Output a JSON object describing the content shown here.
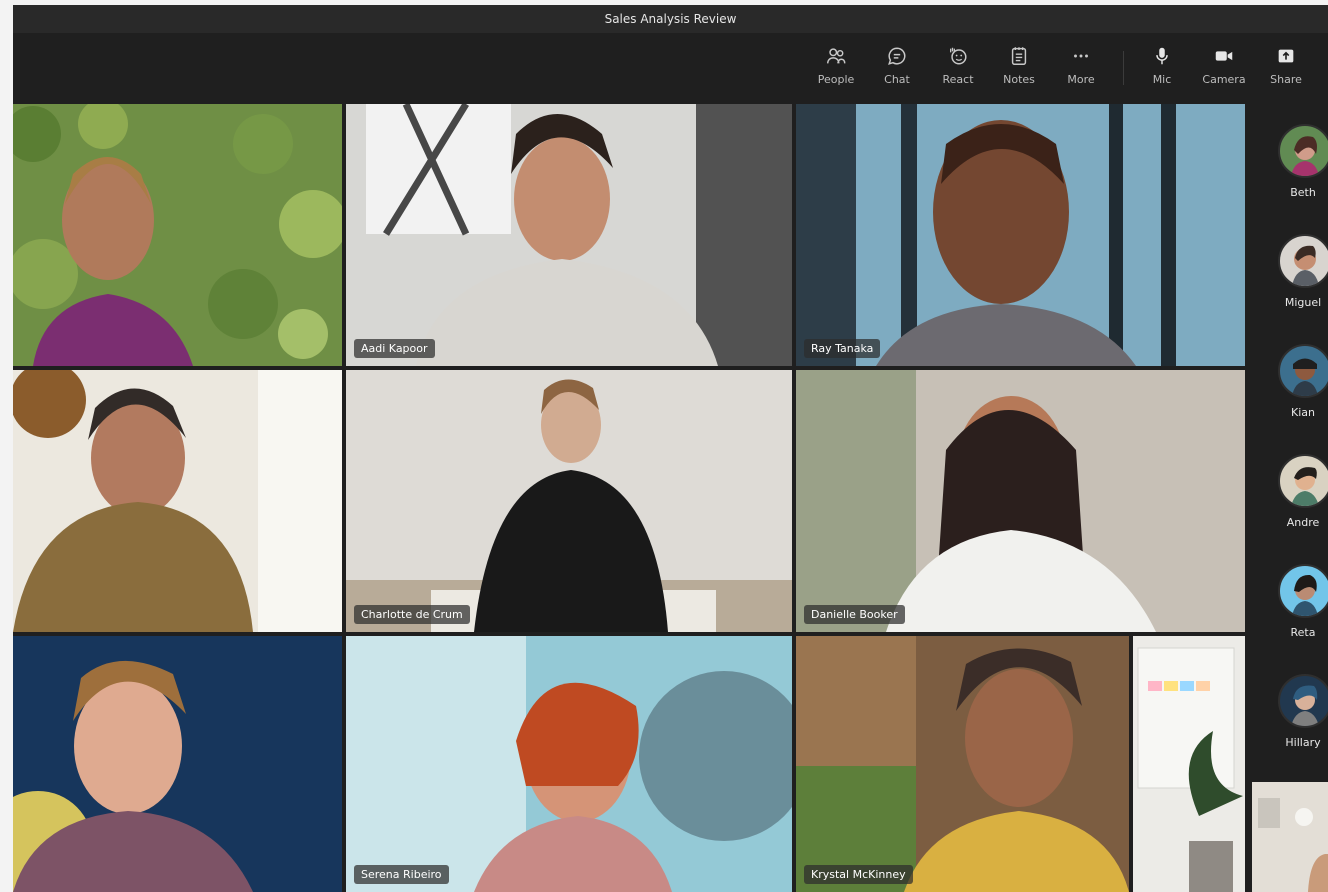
{
  "window": {
    "title": "Sales Analysis Review"
  },
  "toolbar": {
    "buttons": [
      {
        "label": "People",
        "icon": "people-icon"
      },
      {
        "label": "Chat",
        "icon": "chat-icon"
      },
      {
        "label": "React",
        "icon": "react-icon"
      },
      {
        "label": "Notes",
        "icon": "notes-icon"
      },
      {
        "label": "More",
        "icon": "more-icon"
      },
      {
        "label": "Mic",
        "icon": "mic-icon"
      },
      {
        "label": "Camera",
        "icon": "camera-icon"
      },
      {
        "label": "Share",
        "icon": "share-icon"
      }
    ]
  },
  "participants_grid": [
    {
      "name": ""
    },
    {
      "name": "Aadi Kapoor"
    },
    {
      "name": "Ray Tanaka"
    },
    {
      "name": ""
    },
    {
      "name": "Charlotte de Crum"
    },
    {
      "name": "Danielle Booker"
    },
    {
      "name": ""
    },
    {
      "name": "Serena Ribeiro"
    },
    {
      "name": "Krystal McKinney"
    }
  ],
  "sidebar": {
    "people": [
      {
        "name": "Beth"
      },
      {
        "name": "Miguel"
      },
      {
        "name": "Kian"
      },
      {
        "name": "Andre"
      },
      {
        "name": "Reta"
      },
      {
        "name": "Hillary"
      }
    ]
  },
  "colors": {
    "window_bg": "#1f1f1f",
    "titlebar_bg": "#292929",
    "label_text": "#bdbdbd",
    "nametag_bg": "#2d2d2d"
  }
}
